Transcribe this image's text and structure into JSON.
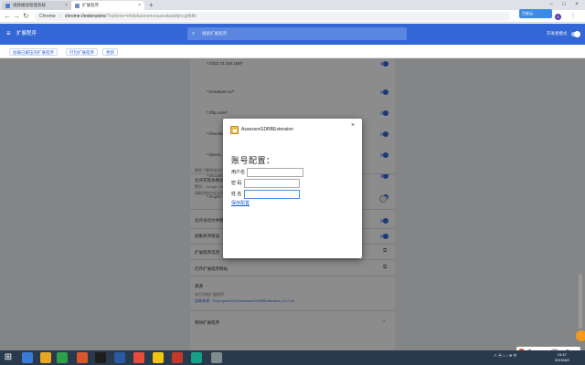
{
  "browser": {
    "tabs": [
      {
        "label": "视频播放管理系统",
        "active": false
      },
      {
        "label": "扩展程序",
        "active": true
      }
    ],
    "address": {
      "product_label": "Chrome",
      "url_host": "chrome://extensions",
      "url_rest": "/?options=ehdekaonencoaeeafadahjncglifdfo"
    },
    "cloud_button": "百度云..."
  },
  "extensions_page": {
    "title": "扩展程序",
    "search_placeholder": "搜索扩展程序",
    "dev_mode_label": "开发者模式",
    "subbar_buttons": [
      "加载已解压的扩展程序",
      "打包扩展程序",
      "更新"
    ],
    "site_rows": [
      "*://202.73.100.168/*",
      "*://codepen.io/*",
      "*://ftp.com/*",
      "*://localhost/*",
      "*://jenni...",
      "*://x.com...",
      "*://x.pre..."
    ],
    "info_line": "移除了解网站访问权限",
    "incognito_row": {
      "title": "允许在隐身模式下运行",
      "desc1": "警告：Google Chrome 无法阻止扩展程序记录您的浏览记录。",
      "desc2": "请取消选中此选项以在隐身模式下停用此扩展程序。"
    },
    "file_url_row": "允许访问文件网址",
    "error_row": "收集各项错误",
    "options_row": "扩展程序选项",
    "store_row": "打开扩展程序网站",
    "source_title": "来源",
    "source_line1": "未打包的扩展程序",
    "source_line2": "加载来源：D:\\project\\2019\\AssessorGDRBExtension_v1.0.21",
    "remove_row": "移除扩展程序"
  },
  "modal": {
    "title": "AssessorGDRBExtension",
    "close_glyph": "×",
    "heading": "账号配置：",
    "fields": [
      {
        "label": "用户名",
        "value": ""
      },
      {
        "label": "密 码",
        "value": ""
      },
      {
        "label": "姓 名",
        "value": ""
      }
    ],
    "save_label": "保存配置"
  },
  "system": {
    "ime_label": "中",
    "time": "13:47",
    "date": "2019/4/8"
  },
  "colors": {
    "header_blue": "#3367d6",
    "link_blue": "#1a5fcf",
    "taskbar": "#2a3a4d"
  }
}
